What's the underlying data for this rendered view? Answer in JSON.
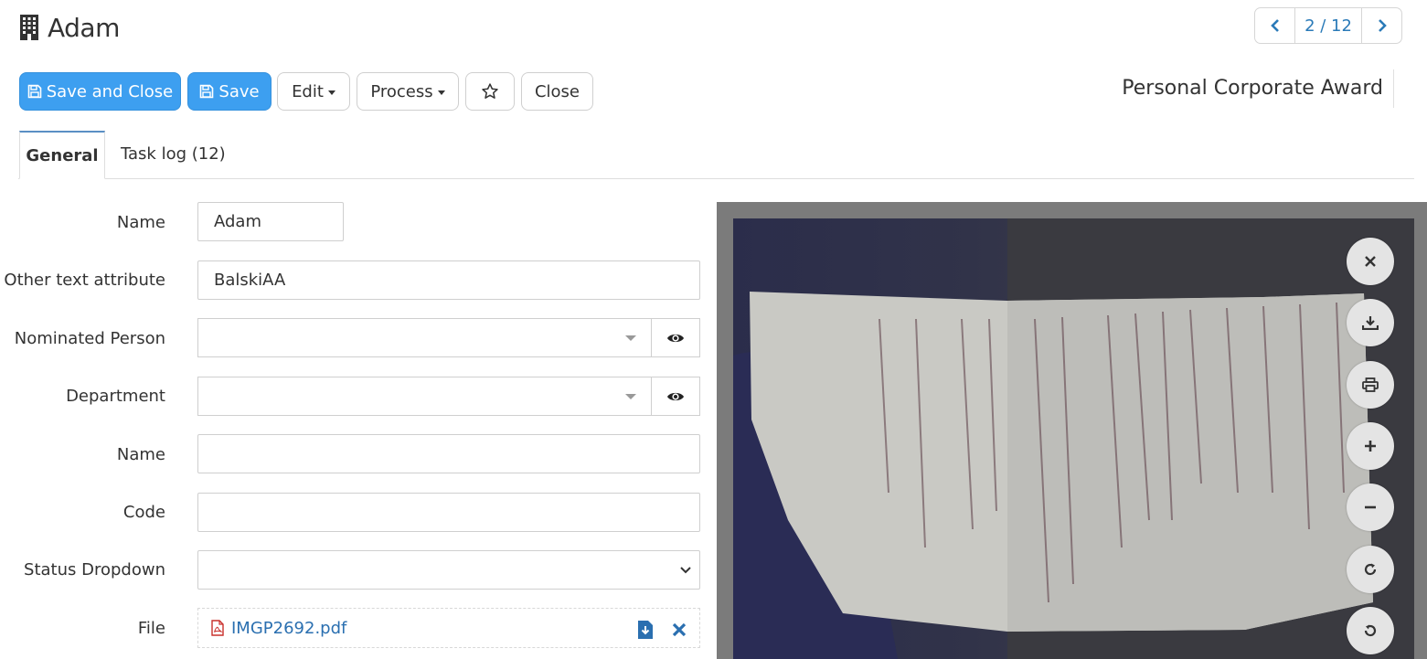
{
  "header": {
    "title": "Adam",
    "pager": "2 / 12"
  },
  "toolbar": {
    "save_close": "Save and Close",
    "save": "Save",
    "edit": "Edit",
    "process": "Process",
    "close": "Close"
  },
  "award_title": "Personal Corporate Award",
  "tabs": {
    "general": "General",
    "task_log": "Task log (12)"
  },
  "form": {
    "name_label": "Name",
    "name_value": "Adam",
    "other_label": "Other text attribute",
    "other_value": "BalskiAA",
    "nominated_label": "Nominated Person",
    "department_label": "Department",
    "name2_label": "Name",
    "code_label": "Code",
    "status_label": "Status Dropdown",
    "file_label": "File",
    "file_name": "IMGP2692.pdf"
  },
  "colors": {
    "primary": "#3d9ff0",
    "link": "#2a6fb0",
    "pdf_icon": "#c9302c"
  },
  "icons": [
    "building-icon",
    "chevron-left-icon",
    "chevron-right-icon",
    "floppy-icon",
    "star-icon",
    "eye-icon",
    "pdf-file-icon",
    "download-icon",
    "remove-icon",
    "close-icon",
    "print-icon",
    "zoom-in-icon",
    "zoom-out-icon",
    "rotate-right-icon",
    "rotate-left-icon"
  ]
}
